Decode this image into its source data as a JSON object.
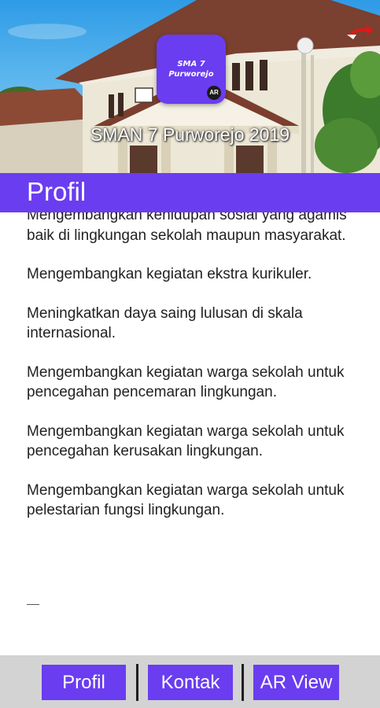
{
  "header": {
    "logo_line1": "SMA 7",
    "logo_line2": "Purworejo",
    "logo_badge": "AR",
    "caption": "SMAN 7 Purworejo 2019"
  },
  "titlebar": {
    "title": "Profil"
  },
  "content": {
    "paragraphs": [
      "Mengembangkan kehidupan sosial yang agamis baik di lingkungan sekolah maupun masyarakat.",
      "Mengembangkan kegiatan ekstra kurikuler.",
      "Meningkatkan daya saing lulusan di skala internasional.",
      "Mengembangkan kegiatan warga sekolah untuk pencegahan pencemaran lingkungan.",
      "Mengembangkan kegiatan warga sekolah untuk pencegahan kerusakan lingkungan.",
      "Mengembangkan kegiatan warga sekolah untuk pelestarian fungsi lingkungan."
    ]
  },
  "nav": {
    "profil": "Profil",
    "kontak": "Kontak",
    "ar_view": "AR View"
  },
  "colors": {
    "accent": "#6a3df0",
    "nav_background": "#d3d3d3",
    "text": "#222222"
  }
}
